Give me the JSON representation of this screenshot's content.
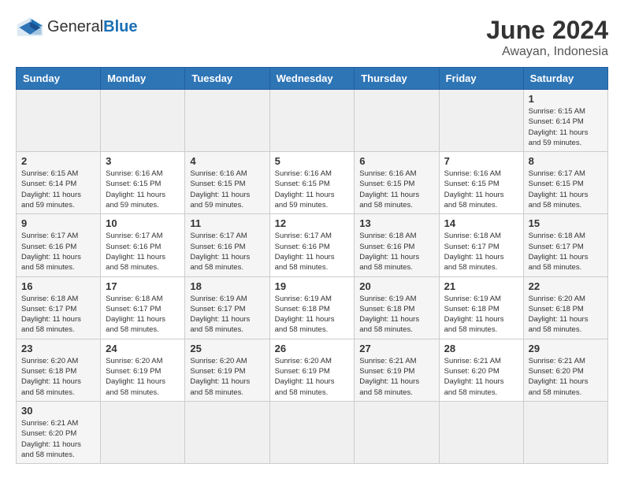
{
  "header": {
    "logo_general": "General",
    "logo_blue": "Blue",
    "month_year": "June 2024",
    "location": "Awayan, Indonesia"
  },
  "days_of_week": [
    "Sunday",
    "Monday",
    "Tuesday",
    "Wednesday",
    "Thursday",
    "Friday",
    "Saturday"
  ],
  "weeks": [
    [
      {
        "day": "",
        "info": ""
      },
      {
        "day": "",
        "info": ""
      },
      {
        "day": "",
        "info": ""
      },
      {
        "day": "",
        "info": ""
      },
      {
        "day": "",
        "info": ""
      },
      {
        "day": "",
        "info": ""
      },
      {
        "day": "1",
        "info": "Sunrise: 6:15 AM\nSunset: 6:14 PM\nDaylight: 11 hours\nand 59 minutes."
      }
    ],
    [
      {
        "day": "2",
        "info": "Sunrise: 6:15 AM\nSunset: 6:14 PM\nDaylight: 11 hours\nand 59 minutes."
      },
      {
        "day": "3",
        "info": "Sunrise: 6:16 AM\nSunset: 6:15 PM\nDaylight: 11 hours\nand 59 minutes."
      },
      {
        "day": "4",
        "info": "Sunrise: 6:16 AM\nSunset: 6:15 PM\nDaylight: 11 hours\nand 59 minutes."
      },
      {
        "day": "5",
        "info": "Sunrise: 6:16 AM\nSunset: 6:15 PM\nDaylight: 11 hours\nand 59 minutes."
      },
      {
        "day": "6",
        "info": "Sunrise: 6:16 AM\nSunset: 6:15 PM\nDaylight: 11 hours\nand 58 minutes."
      },
      {
        "day": "7",
        "info": "Sunrise: 6:16 AM\nSunset: 6:15 PM\nDaylight: 11 hours\nand 58 minutes."
      },
      {
        "day": "8",
        "info": "Sunrise: 6:17 AM\nSunset: 6:15 PM\nDaylight: 11 hours\nand 58 minutes."
      }
    ],
    [
      {
        "day": "9",
        "info": "Sunrise: 6:17 AM\nSunset: 6:16 PM\nDaylight: 11 hours\nand 58 minutes."
      },
      {
        "day": "10",
        "info": "Sunrise: 6:17 AM\nSunset: 6:16 PM\nDaylight: 11 hours\nand 58 minutes."
      },
      {
        "day": "11",
        "info": "Sunrise: 6:17 AM\nSunset: 6:16 PM\nDaylight: 11 hours\nand 58 minutes."
      },
      {
        "day": "12",
        "info": "Sunrise: 6:17 AM\nSunset: 6:16 PM\nDaylight: 11 hours\nand 58 minutes."
      },
      {
        "day": "13",
        "info": "Sunrise: 6:18 AM\nSunset: 6:16 PM\nDaylight: 11 hours\nand 58 minutes."
      },
      {
        "day": "14",
        "info": "Sunrise: 6:18 AM\nSunset: 6:17 PM\nDaylight: 11 hours\nand 58 minutes."
      },
      {
        "day": "15",
        "info": "Sunrise: 6:18 AM\nSunset: 6:17 PM\nDaylight: 11 hours\nand 58 minutes."
      }
    ],
    [
      {
        "day": "16",
        "info": "Sunrise: 6:18 AM\nSunset: 6:17 PM\nDaylight: 11 hours\nand 58 minutes."
      },
      {
        "day": "17",
        "info": "Sunrise: 6:18 AM\nSunset: 6:17 PM\nDaylight: 11 hours\nand 58 minutes."
      },
      {
        "day": "18",
        "info": "Sunrise: 6:19 AM\nSunset: 6:17 PM\nDaylight: 11 hours\nand 58 minutes."
      },
      {
        "day": "19",
        "info": "Sunrise: 6:19 AM\nSunset: 6:18 PM\nDaylight: 11 hours\nand 58 minutes."
      },
      {
        "day": "20",
        "info": "Sunrise: 6:19 AM\nSunset: 6:18 PM\nDaylight: 11 hours\nand 58 minutes."
      },
      {
        "day": "21",
        "info": "Sunrise: 6:19 AM\nSunset: 6:18 PM\nDaylight: 11 hours\nand 58 minutes."
      },
      {
        "day": "22",
        "info": "Sunrise: 6:20 AM\nSunset: 6:18 PM\nDaylight: 11 hours\nand 58 minutes."
      }
    ],
    [
      {
        "day": "23",
        "info": "Sunrise: 6:20 AM\nSunset: 6:18 PM\nDaylight: 11 hours\nand 58 minutes."
      },
      {
        "day": "24",
        "info": "Sunrise: 6:20 AM\nSunset: 6:19 PM\nDaylight: 11 hours\nand 58 minutes."
      },
      {
        "day": "25",
        "info": "Sunrise: 6:20 AM\nSunset: 6:19 PM\nDaylight: 11 hours\nand 58 minutes."
      },
      {
        "day": "26",
        "info": "Sunrise: 6:20 AM\nSunset: 6:19 PM\nDaylight: 11 hours\nand 58 minutes."
      },
      {
        "day": "27",
        "info": "Sunrise: 6:21 AM\nSunset: 6:19 PM\nDaylight: 11 hours\nand 58 minutes."
      },
      {
        "day": "28",
        "info": "Sunrise: 6:21 AM\nSunset: 6:20 PM\nDaylight: 11 hours\nand 58 minutes."
      },
      {
        "day": "29",
        "info": "Sunrise: 6:21 AM\nSunset: 6:20 PM\nDaylight: 11 hours\nand 58 minutes."
      }
    ],
    [
      {
        "day": "30",
        "info": "Sunrise: 6:21 AM\nSunset: 6:20 PM\nDaylight: 11 hours\nand 58 minutes."
      },
      {
        "day": "",
        "info": ""
      },
      {
        "day": "",
        "info": ""
      },
      {
        "day": "",
        "info": ""
      },
      {
        "day": "",
        "info": ""
      },
      {
        "day": "",
        "info": ""
      },
      {
        "day": "",
        "info": ""
      }
    ]
  ]
}
